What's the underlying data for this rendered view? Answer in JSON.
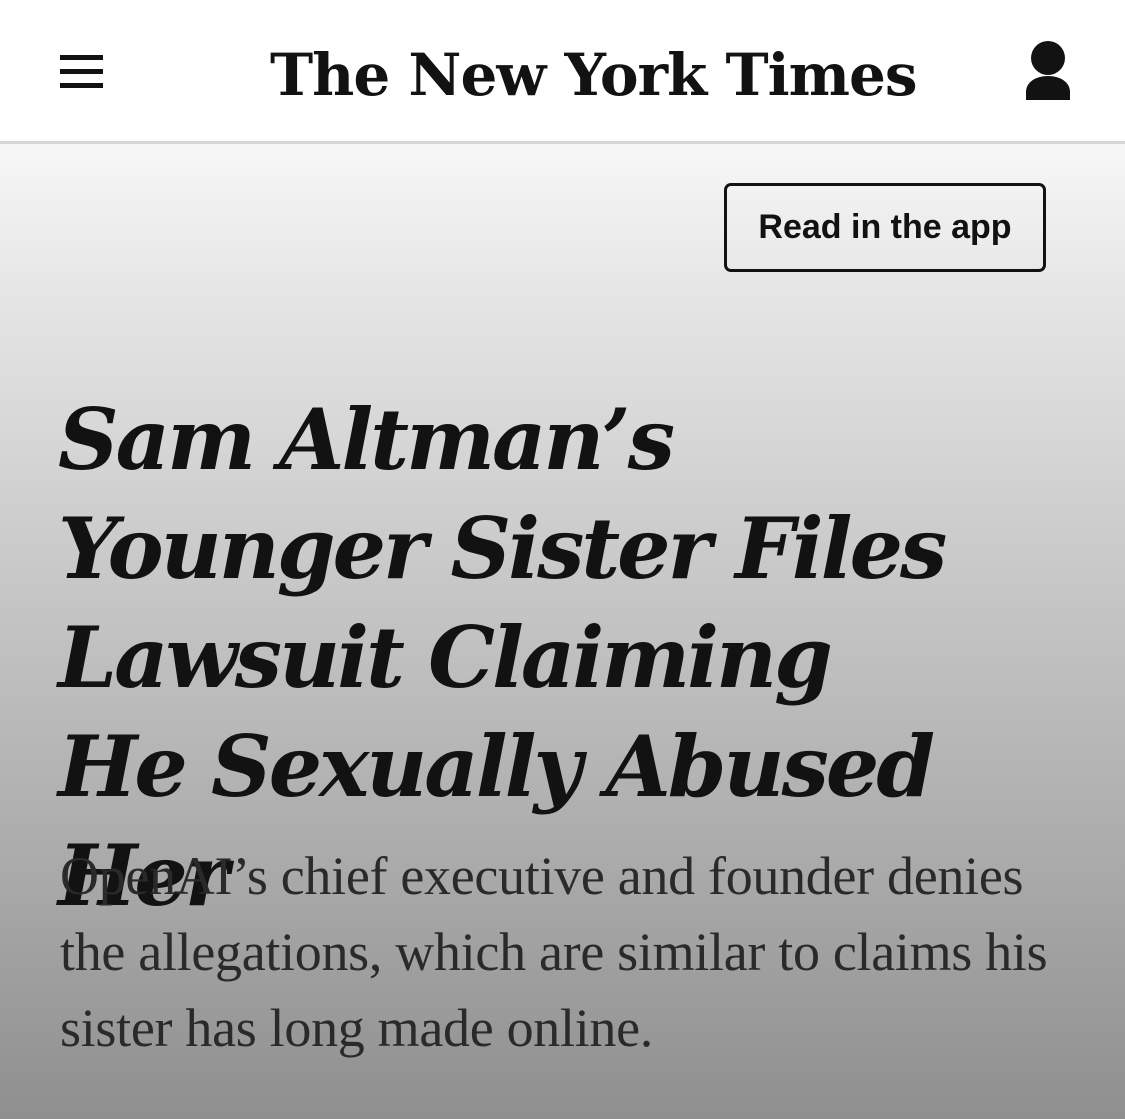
{
  "header": {
    "logo_text": "The New York Times",
    "menu_icon": "hamburger-menu-icon",
    "account_icon": "user-account-icon"
  },
  "banner": {
    "read_in_app_label": "Read in the app"
  },
  "article": {
    "headline": "Sam Altman’s Younger Sister Files Lawsuit Claiming He Sexually Abused Her",
    "summary": "OpenAI’s chief executive and founder denies the allegations, which are similar to claims his sister has long made online."
  },
  "colors": {
    "text": "#121212",
    "header_background": "#ffffff",
    "divider": "#d6d6d6",
    "gradient_top": "#f7f7f7",
    "gradient_bottom": "#8f8f8f"
  }
}
